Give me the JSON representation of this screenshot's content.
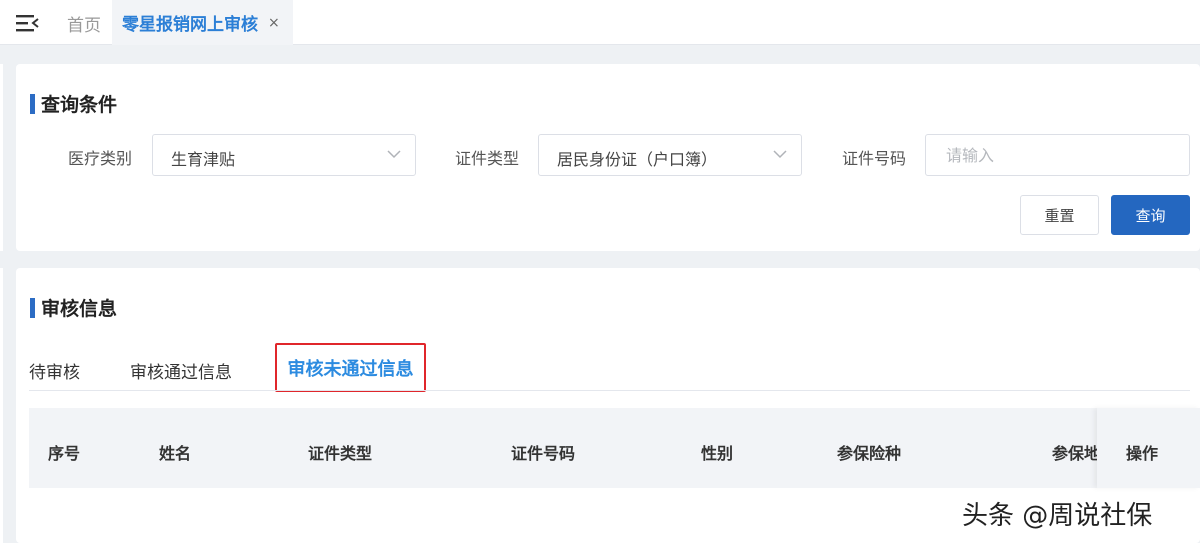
{
  "topbar": {
    "tab_home": "首页",
    "tab_active": "零星报销网上审核",
    "tab_close": "×"
  },
  "query": {
    "title": "查询条件",
    "medical_type_label": "医疗类别",
    "medical_type_value": "生育津贴",
    "id_type_label": "证件类型",
    "id_type_value": "居民身份证（户口簿）",
    "id_number_label": "证件号码",
    "id_number_placeholder": "请输入",
    "reset_label": "重置",
    "query_label": "查询"
  },
  "audit": {
    "title": "审核信息",
    "tabs": [
      "待审核",
      "审核通过信息",
      "审核未通过信息"
    ],
    "active_tab_index": 2,
    "columns": [
      "序号",
      "姓名",
      "证件类型",
      "证件号码",
      "性别",
      "参保险种",
      "参保地",
      "操作"
    ]
  },
  "watermark": "头条 @周说社保",
  "colors": {
    "primary": "#2467c0",
    "active_tab_text": "#2c8be0",
    "highlight_border": "#e0262b",
    "section_bar": "#2c6cc4"
  }
}
